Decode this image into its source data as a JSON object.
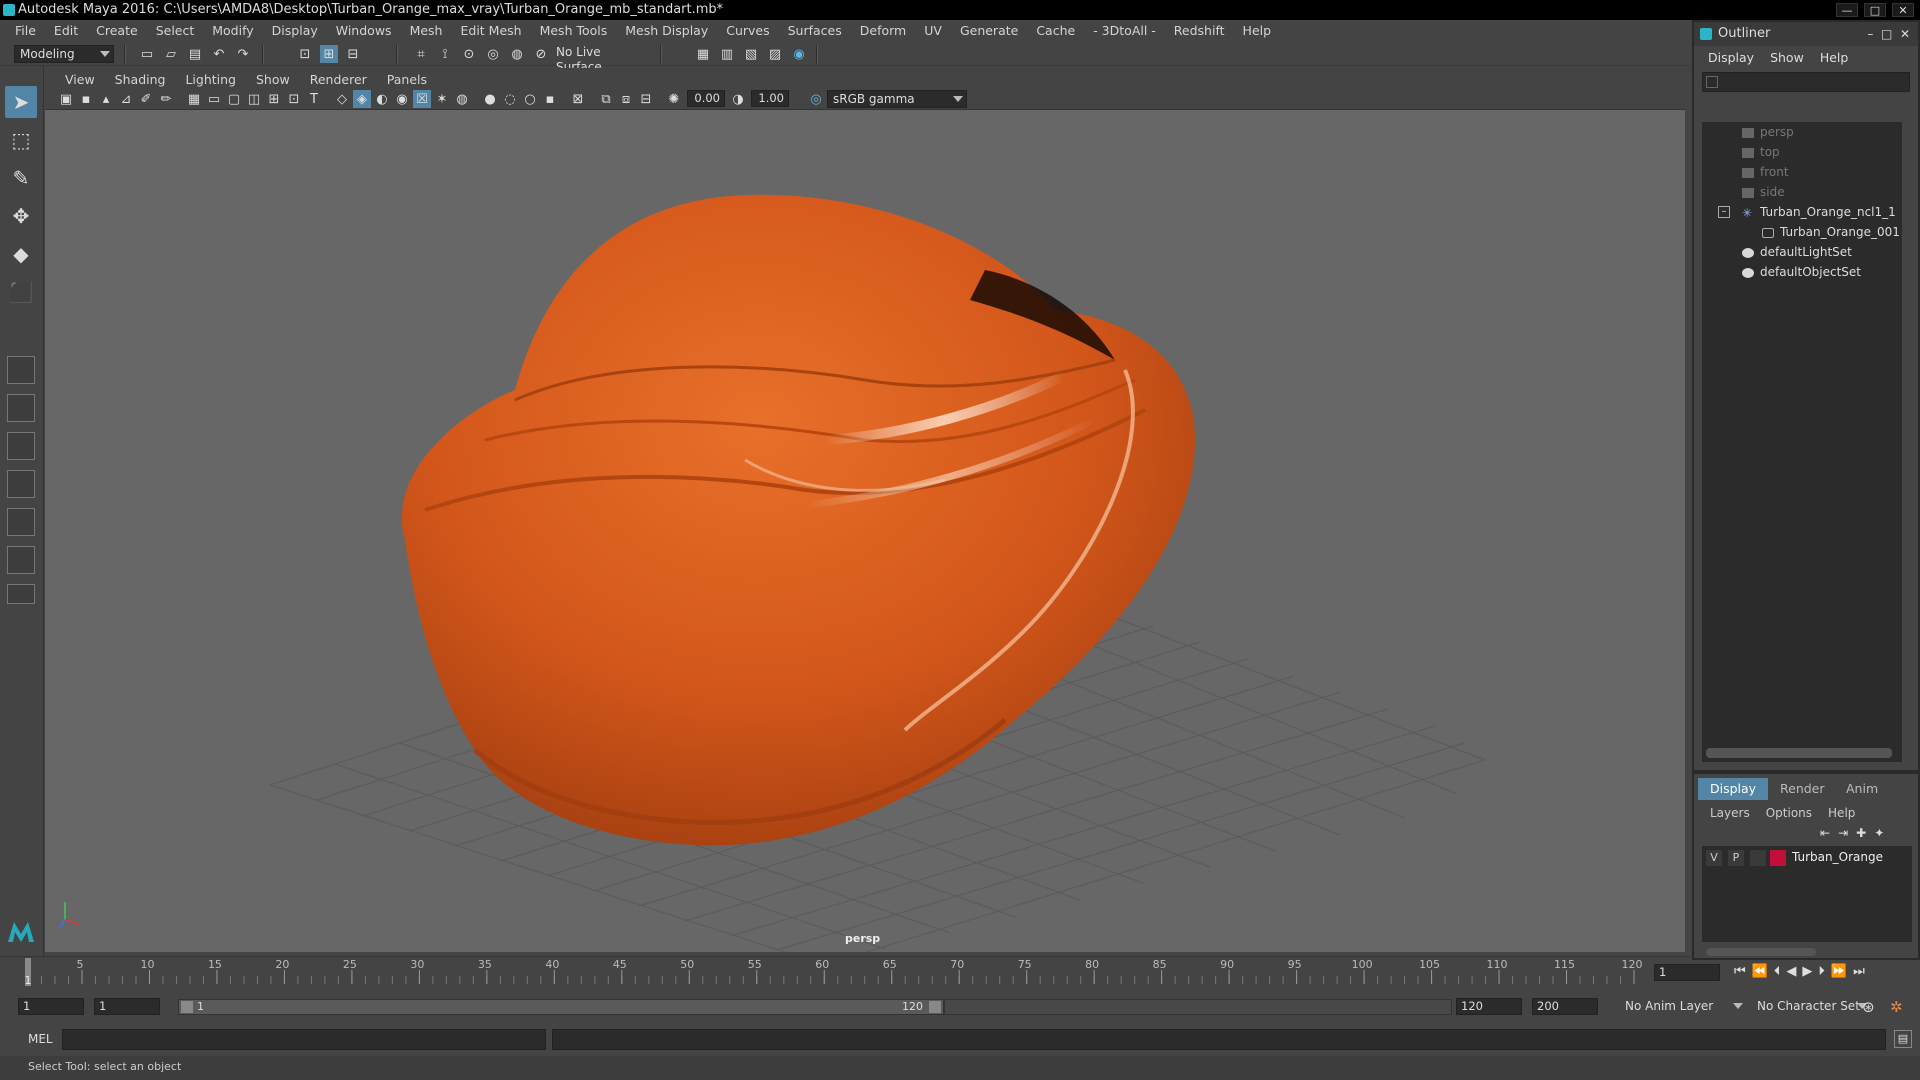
{
  "window": {
    "title": "Autodesk Maya 2016: C:\\Users\\AMDA8\\Desktop\\Turban_Orange_max_vray\\Turban_Orange_mb_standart.mb*",
    "controls": [
      "—",
      "□",
      "✕"
    ]
  },
  "menubar": [
    "File",
    "Edit",
    "Create",
    "Select",
    "Modify",
    "Display",
    "Windows",
    "Mesh",
    "Edit Mesh",
    "Mesh Tools",
    "Mesh Display",
    "Curves",
    "Surfaces",
    "Deform",
    "UV",
    "Generate",
    "Cache",
    "- 3DtoAll -",
    "Redshift",
    "Help"
  ],
  "statusline": {
    "mode": "Modeling",
    "live_surface": "No Live Surface"
  },
  "panel": {
    "menus": [
      "View",
      "Shading",
      "Lighting",
      "Show",
      "Renderer",
      "Panels"
    ],
    "exposure": "0.00",
    "gamma": "1.00",
    "color_space": "sRGB gamma",
    "camera_label": "persp"
  },
  "outliner": {
    "title": "Outliner",
    "menus": [
      "Display",
      "Show",
      "Help"
    ],
    "items": [
      {
        "label": "persp",
        "dim": true
      },
      {
        "label": "top",
        "dim": true
      },
      {
        "label": "front",
        "dim": true
      },
      {
        "label": "side",
        "dim": true
      },
      {
        "label": "Turban_Orange_ncl1_1",
        "dim": false
      },
      {
        "label": "Turban_Orange_001",
        "dim": false
      },
      {
        "label": "defaultLightSet",
        "dim": false
      },
      {
        "label": "defaultObjectSet",
        "dim": false
      }
    ]
  },
  "layer_editor": {
    "tabs": [
      "Display",
      "Render",
      "Anim"
    ],
    "active_tab": "Display",
    "menus": [
      "Layers",
      "Options",
      "Help"
    ],
    "layer": {
      "v": "V",
      "p": "P",
      "name": "Turban_Orange",
      "color": "#c0103a"
    }
  },
  "timeline": {
    "ticks": [
      "1",
      "5",
      "10",
      "15",
      "20",
      "25",
      "30",
      "35",
      "40",
      "45",
      "50",
      "55",
      "60",
      "65",
      "70",
      "75",
      "80",
      "85",
      "90",
      "95",
      "100",
      "105",
      "110",
      "115",
      "120"
    ],
    "current_frame": "1"
  },
  "range": {
    "start": "1",
    "anim_start": "1",
    "slider_start": "1",
    "slider_end": "120",
    "anim_end": "120",
    "end": "200",
    "anim_layer": "No Anim Layer",
    "character_set": "No Character Set"
  },
  "cmdline": {
    "label": "MEL"
  },
  "helpline": "Select Tool: select an object",
  "colors": {
    "accent": "#5285a6",
    "turban": "#d2561a",
    "viewport": "#676767"
  }
}
